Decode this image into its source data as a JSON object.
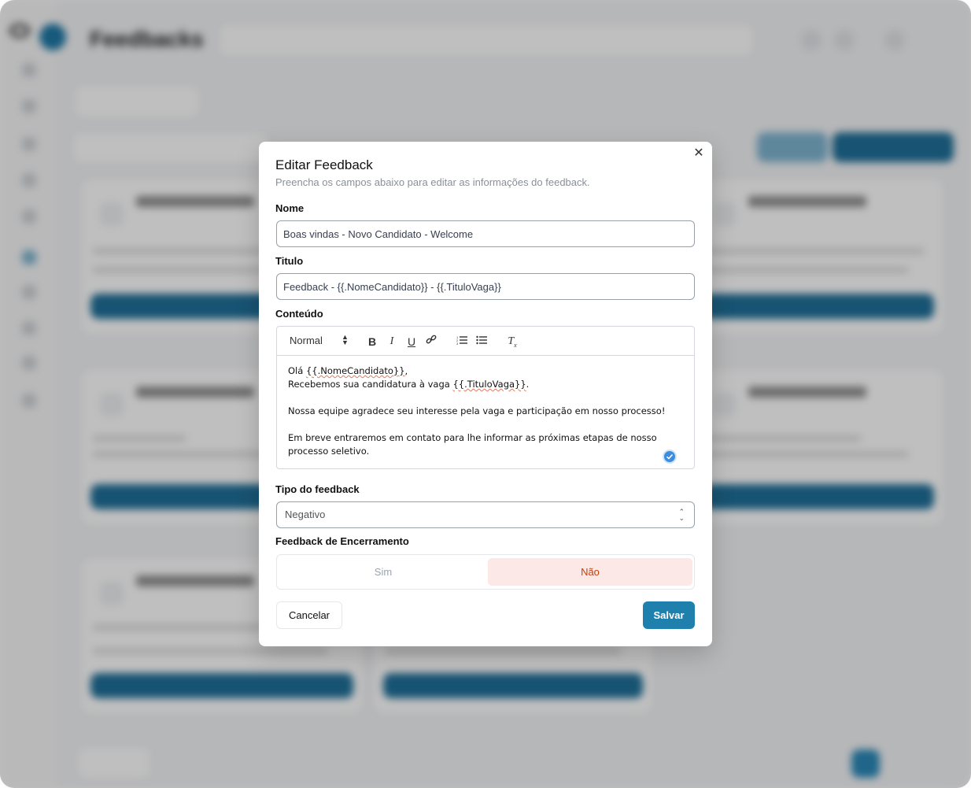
{
  "background": {
    "page_title": "Feedbacks",
    "accent": "#1f78a6"
  },
  "modal": {
    "title": "Editar Feedback",
    "description": "Preencha os campos abaixo para editar as informações do feedback.",
    "close_icon": "close-icon",
    "fields": {
      "name": {
        "label": "Nome",
        "value": "Boas vindas - Novo Candidato - Welcome"
      },
      "title": {
        "label": "Titulo",
        "value": "Feedback - {{.NomeCandidato}} - {{.TituloVaga}}"
      },
      "content": {
        "label": "Conteúdo",
        "toolbar": {
          "style_select": "Normal",
          "buttons": [
            "bold-icon",
            "italic-icon",
            "underline-icon",
            "link-icon",
            "ordered-list-icon",
            "bullet-list-icon",
            "clear-format-icon"
          ]
        },
        "lines": {
          "l1_prefix": "Olá ",
          "l1_var": "{{.NomeCandidato}}",
          "l1_suffix": ",",
          "l2_prefix": "Recebemos sua candidatura à vaga ",
          "l2_var": "{{.TituloVaga}}",
          "l2_suffix": ".",
          "l3": "Nossa equipe agradece seu interesse pela vaga e participação em nosso processo!",
          "l4": "Em breve entraremos em contato para lhe informar as próximas etapas de nosso processo seletivo."
        }
      },
      "type": {
        "label": "Tipo do feedback",
        "value": "Negativo"
      },
      "closing": {
        "label": "Feedback de Encerramento",
        "option_yes": "Sim",
        "option_no": "Não",
        "selected": "Não"
      }
    },
    "actions": {
      "cancel": "Cancelar",
      "save": "Salvar"
    },
    "colors": {
      "primary": "#2080ad",
      "selected_bg": "#fde8e8",
      "selected_text": "#c2410c"
    }
  }
}
